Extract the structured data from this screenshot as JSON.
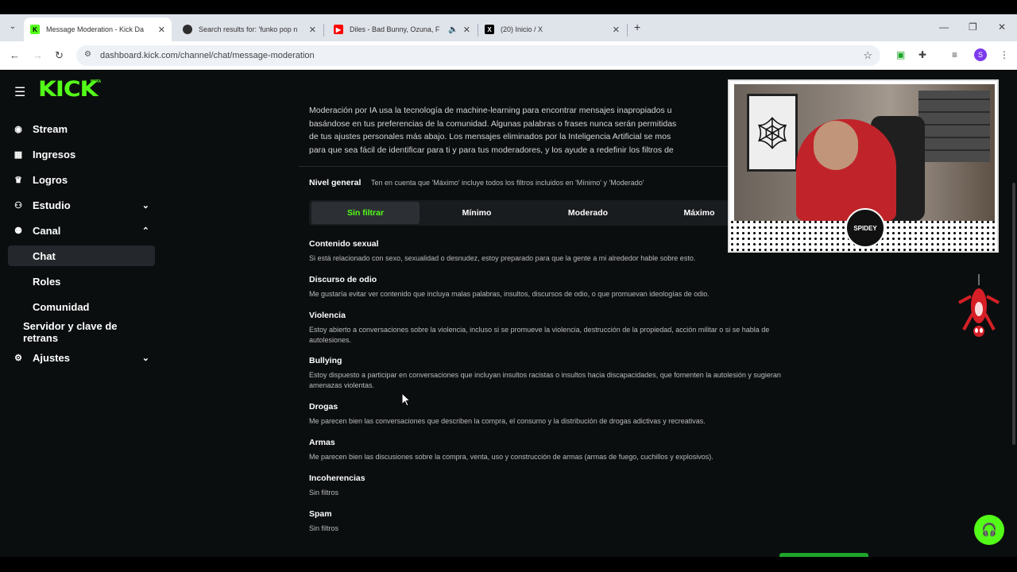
{
  "browser": {
    "tabs": [
      {
        "title": "Message Moderation - Kick Da",
        "icon": "kick-icon",
        "color": "#53fc18",
        "active": true
      },
      {
        "title": "Search results for: 'funko pop n",
        "icon": "search-site-icon",
        "color": "#2d2d2d",
        "active": false
      },
      {
        "title": "Diles - Bad Bunny, Ozuna, F",
        "icon": "youtube-icon",
        "color": "#ff0000",
        "active": false
      },
      {
        "title": "(20) Inicio / X",
        "icon": "x-icon",
        "color": "#000000",
        "active": false
      }
    ],
    "url": "dashboard.kick.com/channel/chat/message-moderation",
    "profile_initial": "S"
  },
  "app": {
    "logo": "KICK",
    "beta": "BETA",
    "brand_color": "#53fc18"
  },
  "sidebar": {
    "items": [
      {
        "label": "Stream",
        "icon": "broadcast-icon",
        "chevron": ""
      },
      {
        "label": "Ingresos",
        "icon": "chart-icon",
        "chevron": ""
      },
      {
        "label": "Logros",
        "icon": "trophy-icon",
        "chevron": ""
      },
      {
        "label": "Estudio",
        "icon": "studio-icon",
        "chevron": "down"
      },
      {
        "label": "Canal",
        "icon": "channel-icon",
        "chevron": "up"
      },
      {
        "label": "Chat",
        "icon": "",
        "chevron": "",
        "sub": true,
        "active": true
      },
      {
        "label": "Roles",
        "icon": "",
        "chevron": "",
        "sub": true
      },
      {
        "label": "Comunidad",
        "icon": "",
        "chevron": "",
        "sub": true
      },
      {
        "label": "Servidor y clave de retrans",
        "icon": "",
        "chevron": "",
        "indent": true
      },
      {
        "label": "Ajustes",
        "icon": "gear-icon",
        "chevron": "down"
      }
    ]
  },
  "intro": {
    "lines": [
      "Moderación por IA usa la tecnología de machine-learning para encontrar mensajes inapropiados u",
      "basándose en tus preferencias de la comunidad. Algunas palabras o frases nunca serán permitidas",
      "de tus ajustes personales más abajo. Los mensajes eliminados por la Inteligencia Artificial se mos",
      "para que sea fácil de identificar para ti y para tus moderadores, y los ayude a redefinir los filtros de"
    ]
  },
  "level": {
    "title": "Nivel general",
    "description": "Ten en cuenta que 'Máximo' incluye todos los filtros incluidos en 'Mínimo' y 'Moderado'",
    "options": [
      "Sin filtrar",
      "Mínimo",
      "Moderado",
      "Máximo"
    ],
    "selected": "Sin filtrar"
  },
  "filters": [
    {
      "name": "Contenido sexual",
      "desc": "Si está relacionado con sexo, sexualidad o desnudez, estoy preparado para que la gente a mi alrededor hable sobre esto."
    },
    {
      "name": "Discurso de odio",
      "desc": "Me gustaría evitar ver contenido que incluya malas palabras, insultos, discursos de odio, o que promuevan ideologías de odio."
    },
    {
      "name": "Violencia",
      "desc": "Estoy abierto a conversaciones sobre la violencia, incluso si se promueve la violencia, destrucción de la propiedad, acción militar o si se habla de",
      "desc2": "autolesiones."
    },
    {
      "name": "Bullying",
      "desc": "Estoy dispuesto a participar en conversaciones que incluyan insultos racistas o insultos hacia discapacidades, que fomenten la autolesión y sugieran",
      "desc2": "amenazas violentas."
    },
    {
      "name": "Drogas",
      "desc": "Me parecen bien las conversaciones que describen la compra, el consumo y la distribución de drogas adictivas y recreativas."
    },
    {
      "name": "Armas",
      "desc": "Me parecen bien las discusiones sobre la compra, venta, uso y construcción de armas (armas de fuego, cuchillos y explosivos)."
    },
    {
      "name": "Incoherencias",
      "desc": "Sin filtros"
    },
    {
      "name": "Spam",
      "desc": "Sin filtros"
    }
  ],
  "overlay": {
    "badge_text": "SPIDEY"
  }
}
